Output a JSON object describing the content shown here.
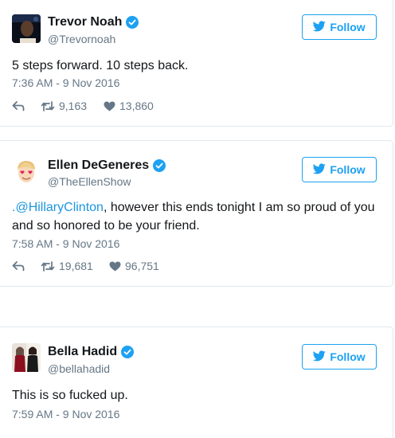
{
  "tweets": [
    {
      "name": "Trevor Noah",
      "handle": "@Trevornoah",
      "follow_label": "Follow",
      "text": "5 steps forward. 10 steps back.",
      "timestamp": "7:36 AM - 9 Nov 2016",
      "retweets": "9,163",
      "likes": "13,860"
    },
    {
      "name": "Ellen DeGeneres",
      "handle": "@TheEllenShow",
      "follow_label": "Follow",
      "text_mention": ".@HillaryClinton",
      "text_rest": ", however this ends tonight I am so proud of you and so honored to be your friend.",
      "timestamp": "7:58 AM - 9 Nov 2016",
      "retweets": "19,681",
      "likes": "96,751"
    },
    {
      "name": "Bella Hadid",
      "handle": "@bellahadid",
      "follow_label": "Follow",
      "text": "This is so fucked up.",
      "timestamp": "7:59 AM - 9 Nov 2016"
    }
  ],
  "colors": {
    "twitter_blue": "#1da1f2",
    "link_blue": "#1b95e0",
    "secondary_text": "#657786",
    "border": "#e1e8ed"
  },
  "icons": [
    "verified-icon",
    "twitter-bird-icon",
    "reply-icon",
    "retweet-icon",
    "heart-icon"
  ]
}
